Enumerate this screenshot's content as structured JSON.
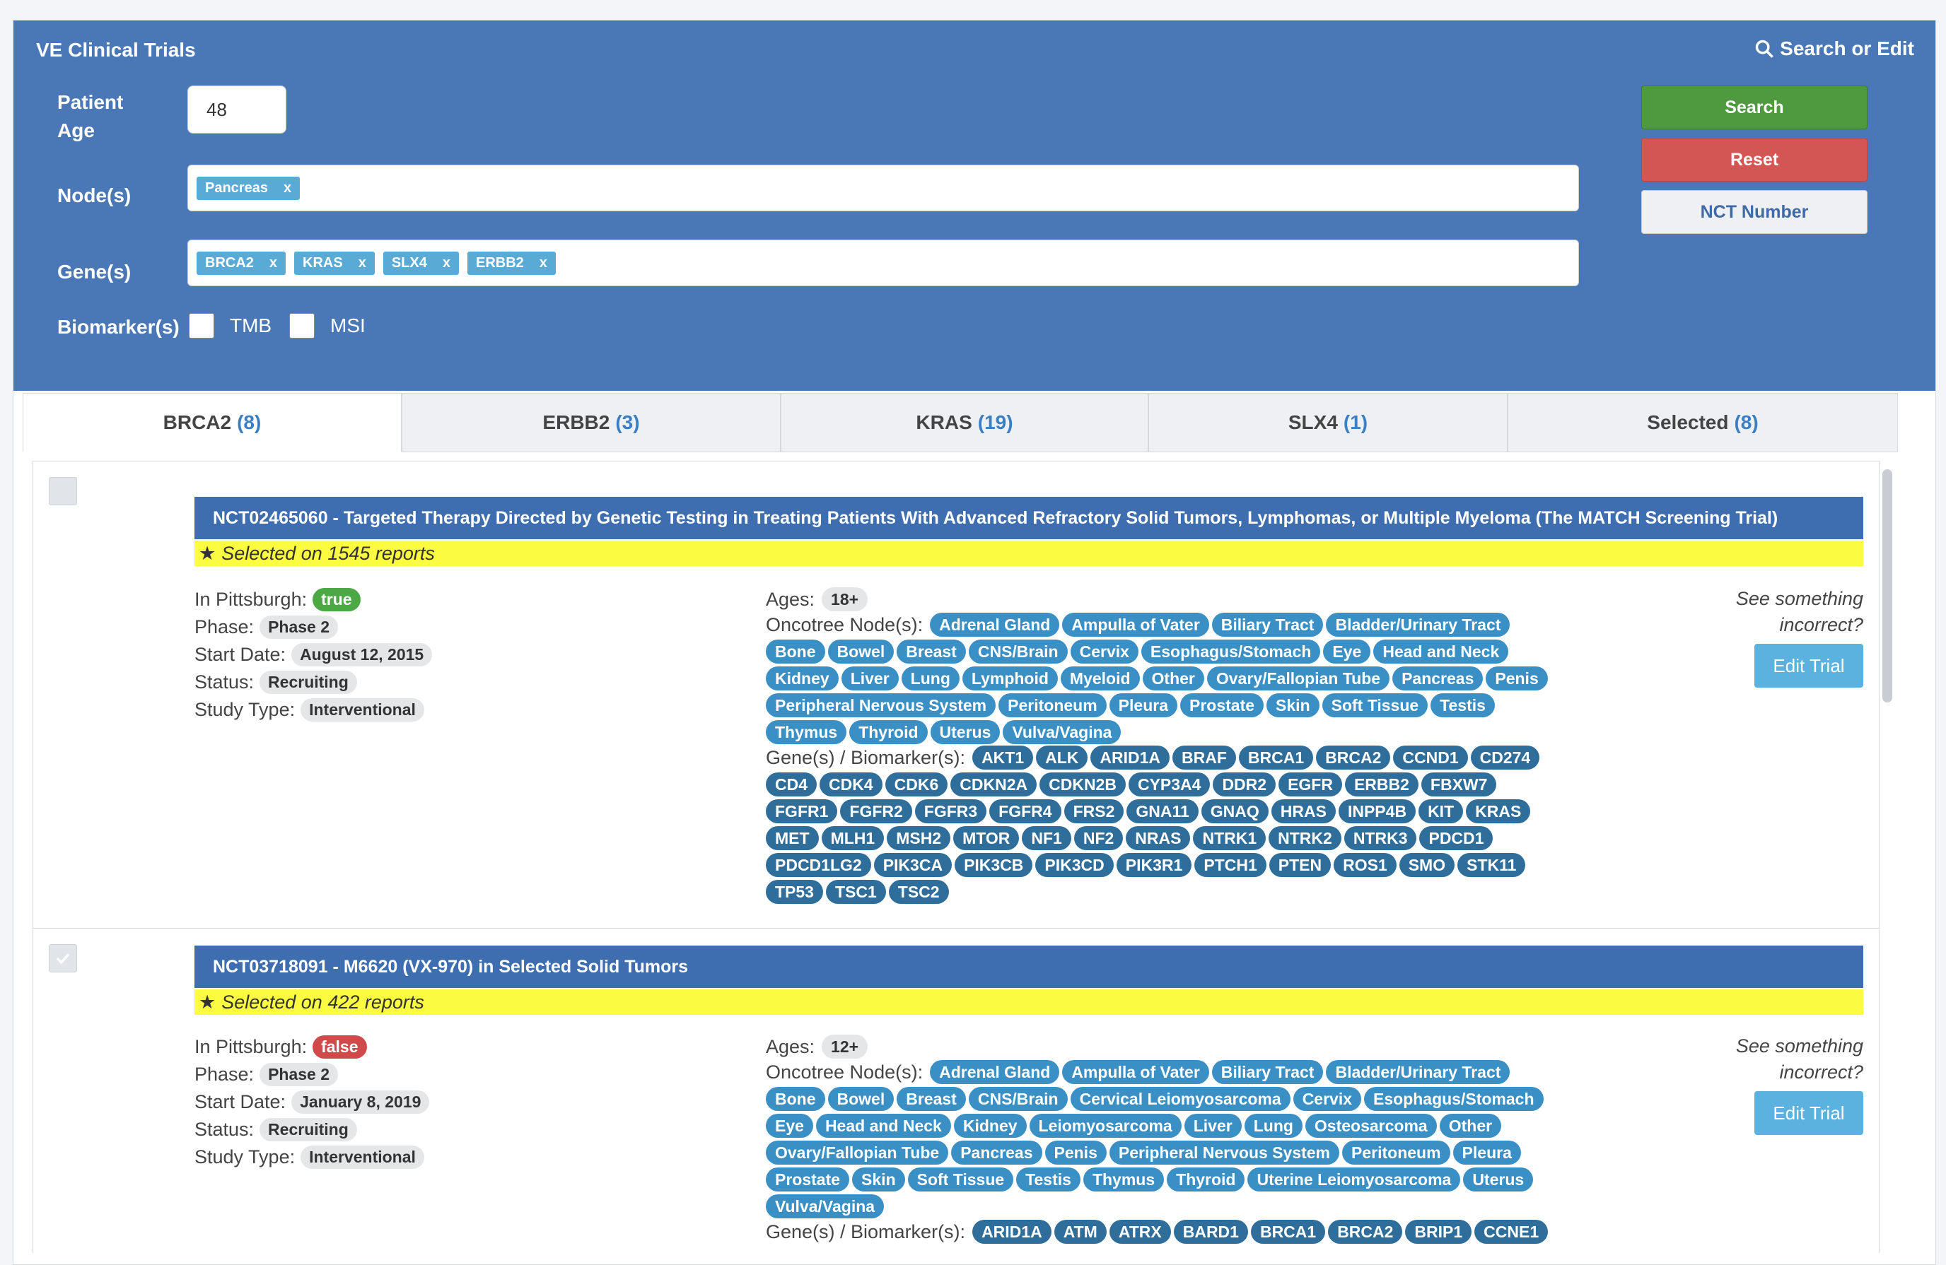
{
  "app": {
    "title": "VE Clinical Trials",
    "search_or_edit": "Search or Edit"
  },
  "form": {
    "age_label": "Patient Age",
    "age_value": "48",
    "nodes_label": "Node(s)",
    "nodes": [
      "Pancreas"
    ],
    "genes_label": "Gene(s)",
    "genes": [
      "BRCA2",
      "KRAS",
      "SLX4",
      "ERBB2"
    ],
    "remove_glyph": "x",
    "biomarkers_label": "Biomarker(s)",
    "biomarkers": [
      "TMB",
      "MSI"
    ]
  },
  "buttons": {
    "search": "Search",
    "reset": "Reset",
    "nct": "NCT Number"
  },
  "colors": {
    "panel": "#4a78b6",
    "search": "#4f9a3f",
    "reset": "#d45654",
    "title_bar": "#3e6eb0",
    "highlight": "#fbfb42",
    "chip": "#3a8fc4"
  },
  "tabs": [
    {
      "label": "BRCA2",
      "count": "(8)",
      "active": true
    },
    {
      "label": "ERBB2",
      "count": "(3)"
    },
    {
      "label": "KRAS",
      "count": "(19)"
    },
    {
      "label": "SLX4",
      "count": "(1)"
    },
    {
      "label": "Selected",
      "count": "(8)"
    }
  ],
  "labels": {
    "in_pittsburgh": "In Pittsburgh:",
    "phase": "Phase:",
    "start_date": "Start Date:",
    "status": "Status:",
    "study_type": "Study Type:",
    "ages": "Ages:",
    "oncotree": "Oncotree Node(s):",
    "genes_biomarkers": "Gene(s) / Biomarker(s):",
    "see_incorrect_1": "See something",
    "see_incorrect_2": "incorrect?",
    "edit_trial": "Edit Trial"
  },
  "trials": [
    {
      "title": "NCT02465060 - Targeted Therapy Directed by Genetic Testing in Treating Patients With Advanced Refractory Solid Tumors, Lymphomas, or Multiple Myeloma (The MATCH Screening Trial)",
      "selected_text": "Selected on 1545 reports",
      "in_pittsburgh": "true",
      "phase": "Phase 2",
      "start_date": "August 12, 2015",
      "status": "Recruiting",
      "study_type": "Interventional",
      "ages": "18+",
      "nodes": [
        "Adrenal Gland",
        "Ampulla of Vater",
        "Biliary Tract",
        "Bladder/Urinary Tract",
        "Bone",
        "Bowel",
        "Breast",
        "CNS/Brain",
        "Cervix",
        "Esophagus/Stomach",
        "Eye",
        "Head and Neck",
        "Kidney",
        "Liver",
        "Lung",
        "Lymphoid",
        "Myeloid",
        "Other",
        "Ovary/Fallopian Tube",
        "Pancreas",
        "Penis",
        "Peripheral Nervous System",
        "Peritoneum",
        "Pleura",
        "Prostate",
        "Skin",
        "Soft Tissue",
        "Testis",
        "Thymus",
        "Thyroid",
        "Uterus",
        "Vulva/Vagina"
      ],
      "genes": [
        "AKT1",
        "ALK",
        "ARID1A",
        "BRAF",
        "BRCA1",
        "BRCA2",
        "CCND1",
        "CD274",
        "CD4",
        "CDK4",
        "CDK6",
        "CDKN2A",
        "CDKN2B",
        "CYP3A4",
        "DDR2",
        "EGFR",
        "ERBB2",
        "FBXW7",
        "FGFR1",
        "FGFR2",
        "FGFR3",
        "FGFR4",
        "FRS2",
        "GNA11",
        "GNAQ",
        "HRAS",
        "INPP4B",
        "KIT",
        "KRAS",
        "MET",
        "MLH1",
        "MSH2",
        "MTOR",
        "NF1",
        "NF2",
        "NRAS",
        "NTRK1",
        "NTRK2",
        "NTRK3",
        "PDCD1",
        "PDCD1LG2",
        "PIK3CA",
        "PIK3CB",
        "PIK3CD",
        "PIK3R1",
        "PTCH1",
        "PTEN",
        "ROS1",
        "SMO",
        "STK11",
        "TP53",
        "TSC1",
        "TSC2"
      ]
    },
    {
      "title": "NCT03718091 - M6620 (VX-970) in Selected Solid Tumors",
      "selected_text": "Selected on 422 reports",
      "in_pittsburgh": "false",
      "phase": "Phase 2",
      "start_date": "January 8, 2019",
      "status": "Recruiting",
      "study_type": "Interventional",
      "ages": "12+",
      "nodes": [
        "Adrenal Gland",
        "Ampulla of Vater",
        "Biliary Tract",
        "Bladder/Urinary Tract",
        "Bone",
        "Bowel",
        "Breast",
        "CNS/Brain",
        "Cervical Leiomyosarcoma",
        "Cervix",
        "Esophagus/Stomach",
        "Eye",
        "Head and Neck",
        "Kidney",
        "Leiomyosarcoma",
        "Liver",
        "Lung",
        "Osteosarcoma",
        "Other",
        "Ovary/Fallopian Tube",
        "Pancreas",
        "Penis",
        "Peripheral Nervous System",
        "Peritoneum",
        "Pleura",
        "Prostate",
        "Skin",
        "Soft Tissue",
        "Testis",
        "Thymus",
        "Thyroid",
        "Uterine Leiomyosarcoma",
        "Uterus",
        "Vulva/Vagina"
      ],
      "genes": [
        "ARID1A",
        "ATM",
        "ATRX",
        "BARD1",
        "BRCA1",
        "BRCA2",
        "BRIP1",
        "CCNE1"
      ]
    }
  ]
}
